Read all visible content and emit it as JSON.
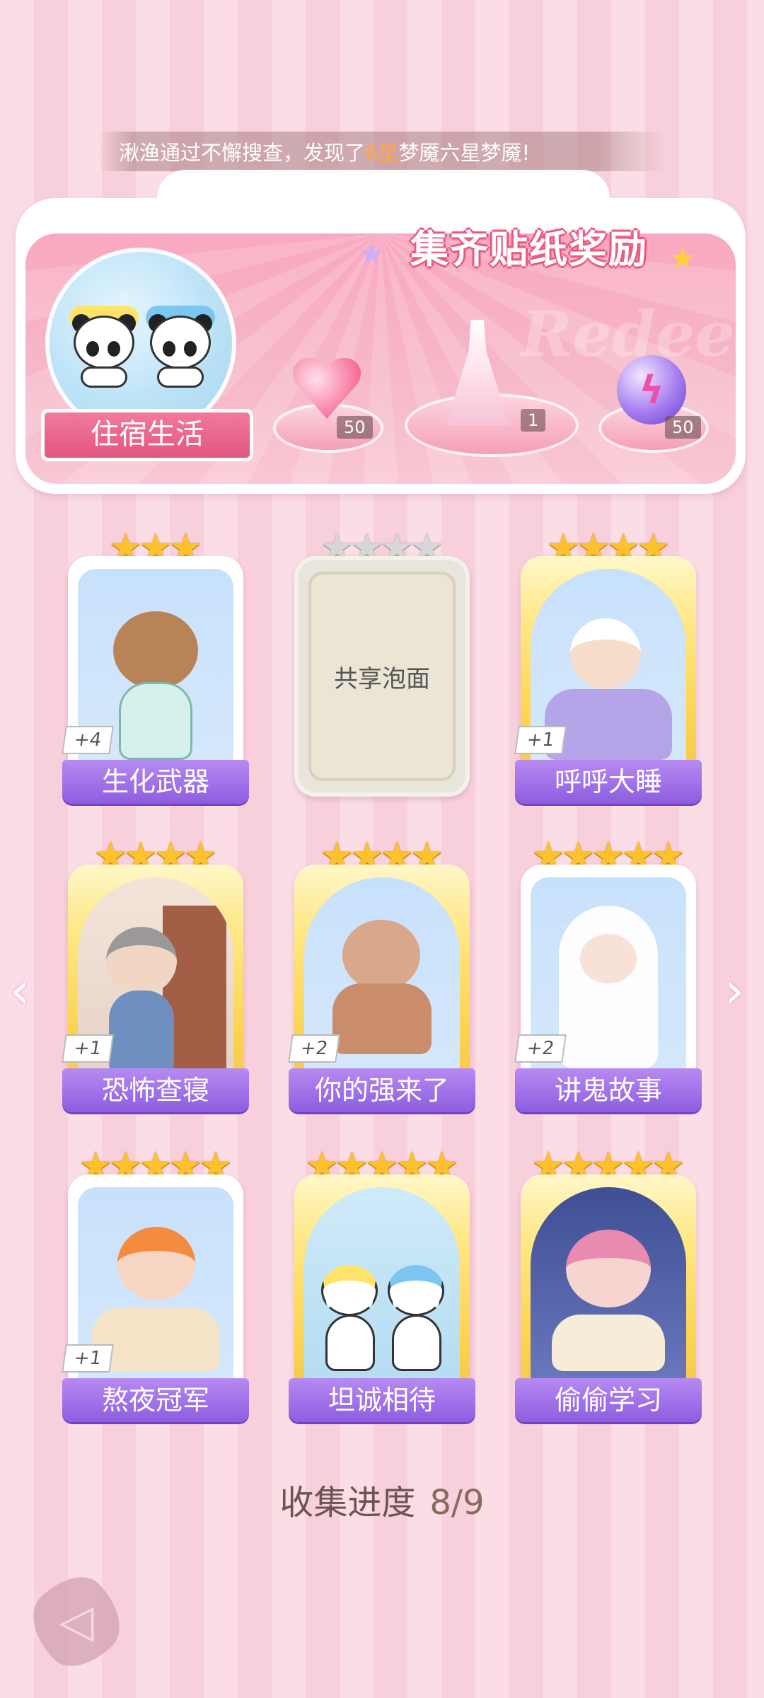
{
  "ticker": {
    "prefix": "湫渔通过不懈搜查，发现了",
    "highlight": "6星",
    "suffix": "梦魇六星梦魇!"
  },
  "reward_panel": {
    "title": "集齐贴纸奖励",
    "watermark": "Redeem",
    "collection_name": "住宿生活",
    "rewards": [
      {
        "icon": "heart-gem-icon",
        "count": "50"
      },
      {
        "icon": "dress-outfit-icon",
        "count": "1"
      },
      {
        "icon": "energy-orb-icon",
        "count": "50"
      }
    ]
  },
  "cards": [
    {
      "name": "生化武器",
      "stars": 3,
      "plus": "+4",
      "collected": true,
      "theme": "capybara"
    },
    {
      "name": "共享泡面",
      "stars": 4,
      "plus": "",
      "collected": false,
      "theme": "locked"
    },
    {
      "name": "呼呼大睡",
      "stars": 4,
      "plus": "+1",
      "collected": true,
      "theme": "sleep"
    },
    {
      "name": "恐怖查寝",
      "stars": 4,
      "plus": "+1",
      "collected": true,
      "theme": "dorm-check"
    },
    {
      "name": "你的强来了",
      "stars": 4,
      "plus": "+2",
      "collected": true,
      "theme": "bug"
    },
    {
      "name": "讲鬼故事",
      "stars": 5,
      "plus": "+2",
      "collected": true,
      "theme": "ghost"
    },
    {
      "name": "熬夜冠军",
      "stars": 5,
      "plus": "+1",
      "collected": true,
      "theme": "phone-bed"
    },
    {
      "name": "坦诚相待",
      "stars": 5,
      "plus": "",
      "collected": true,
      "theme": "pandas"
    },
    {
      "name": "偷偷学习",
      "stars": 5,
      "plus": "",
      "collected": true,
      "theme": "study"
    }
  ],
  "progress": {
    "label": "收集进度",
    "value": "8/9"
  },
  "nav": {
    "prev": "‹",
    "next": "›"
  },
  "colors": {
    "accent": "#8d5de0",
    "star": "#fbc22e",
    "brand_pink": "#f27a9c"
  }
}
